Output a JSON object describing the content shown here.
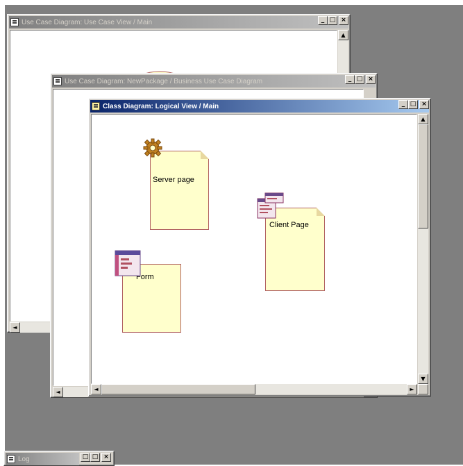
{
  "windows": {
    "back": {
      "title": "Use Case Diagram: Use Case View / Main"
    },
    "middle": {
      "title": "Use Case Diagram: NewPackage / Business Use Case Diagram"
    },
    "front": {
      "title": "Class Diagram: Logical View / Main"
    }
  },
  "controls": {
    "minimize": "_",
    "maximize": "□",
    "close": "×",
    "scroll_up": "▲",
    "scroll_down": "▼",
    "scroll_left": "◄",
    "scroll_right": "►"
  },
  "diagram": {
    "elements": [
      {
        "label": "Server page",
        "stereotype_icon": "gear-icon"
      },
      {
        "label": "Client Page",
        "stereotype_icon": "client-page-icon"
      },
      {
        "label": "Form",
        "stereotype_icon": "form-icon"
      }
    ]
  },
  "log_window": {
    "title": "Log"
  },
  "colors": {
    "mdi_background": "#7f7f7f",
    "active_title_start": "#0a246a",
    "active_title_end": "#a6caf0",
    "note_fill": "#ffffcc",
    "note_border": "#b06060",
    "gear": "#c08020"
  }
}
